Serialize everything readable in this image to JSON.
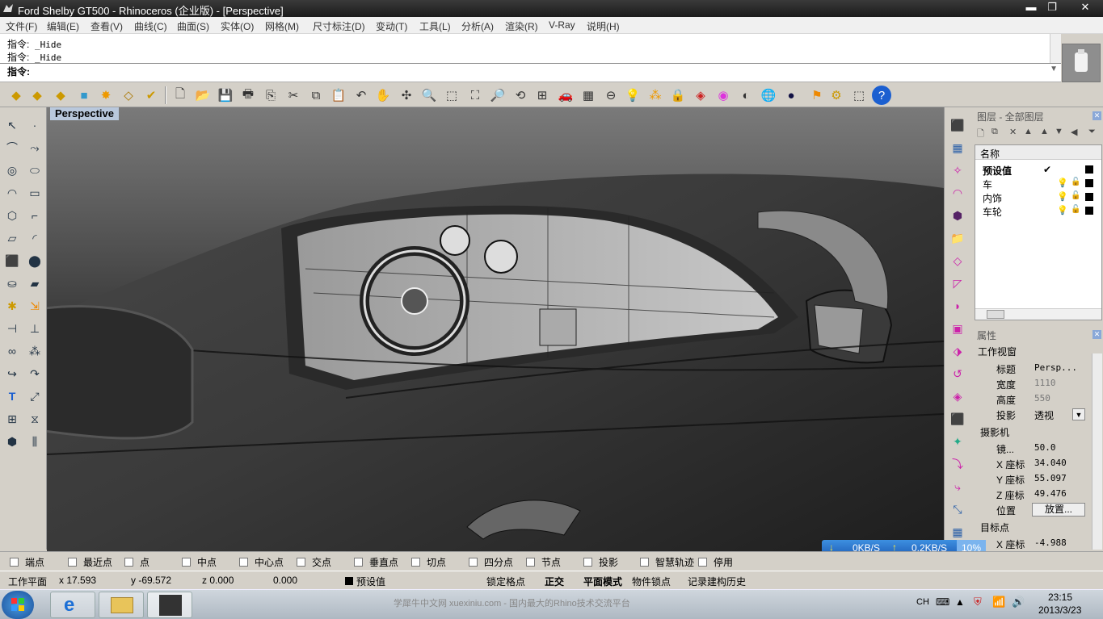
{
  "window": {
    "title": "Ford Shelby GT500 - Rhinoceros (企业版) - [Perspective]",
    "min": "▬",
    "restore": "❐",
    "close": "✕"
  },
  "menu": [
    "文件(F)",
    "编辑(E)",
    "查看(V)",
    "曲线(C)",
    "曲面(S)",
    "实体(O)",
    "网格(M)",
    "尺寸标注(D)",
    "变动(T)",
    "工具(L)",
    "分析(A)",
    "渲染(R)",
    "V-Ray",
    "说明(H)"
  ],
  "command": {
    "history": [
      {
        "label": "指令:",
        "value": "_Hide"
      },
      {
        "label": "指令:",
        "value": "_Hide"
      }
    ],
    "prompt": "指令:"
  },
  "viewport": {
    "title": "Perspective"
  },
  "layers": {
    "header": "图层 - 全部图层",
    "column": "名称",
    "default_row": "预设值",
    "default_check": "✔",
    "rows": [
      "车",
      "内饰",
      "车轮"
    ]
  },
  "properties": {
    "header": "属性",
    "section_viewport": "工作视窗",
    "title_label": "标题",
    "title_value": "Persp...",
    "width_label": "宽度",
    "width_value": "1110",
    "height_label": "高度",
    "height_value": "550",
    "proj_label": "投影",
    "proj_value": "透视",
    "section_camera": "摄影机",
    "lens_label": "镜...",
    "lens_value": "50.0",
    "x_label": "X 座标",
    "x_value": "34.040",
    "y_label": "Y 座标",
    "y_value": "55.097",
    "z_label": "Z 座标",
    "z_value": "49.476",
    "pos_label": "位置",
    "place_button": "放置...",
    "section_target": "目标点",
    "tx_label": "X 座标",
    "tx_value": "-4.988"
  },
  "osnap": [
    "端点",
    "最近点",
    "点",
    "中点",
    "中心点",
    "交点",
    "垂直点",
    "切点",
    "四分点",
    "节点",
    "投影",
    "智慧轨迹",
    "停用"
  ],
  "status": {
    "plane": "工作平面",
    "x": "x 17.593",
    "y": "y -69.572",
    "z": "z 0.000",
    "dist": "0.000",
    "layer": "预设值",
    "grid_snap": "锁定格点",
    "ortho": "正交",
    "planar": "平面模式",
    "obj_snap": "物件锁点",
    "history": "记录建构历史"
  },
  "network": {
    "down": "0KB/S",
    "up": "0.2KB/S",
    "pct": "10%"
  },
  "taskbar": {
    "watermark": "学犀牛中文网 xuexiniu.com - 国内最大的Rhino技术交流平台",
    "ime": "CH",
    "time": "23:15",
    "date": "2013/3/23"
  }
}
